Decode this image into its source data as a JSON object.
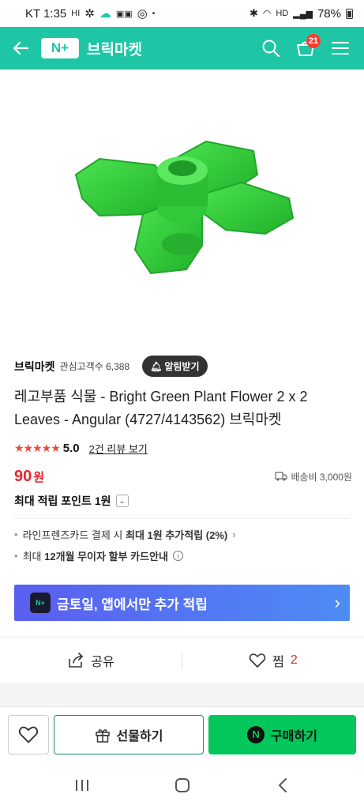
{
  "status_bar": {
    "carrier_time": "KT 1:35",
    "hi": "HI",
    "dot": "•",
    "hd": "HD",
    "battery": "78%"
  },
  "header": {
    "logo": "N+",
    "title": "브릭마켓",
    "cart_count": "21"
  },
  "store": {
    "name": "브릭마켓",
    "fans": "관심고객수 6,388",
    "alarm_label": "알림받기"
  },
  "product": {
    "title": "레고부품 식물 - Bright Green Plant Flower 2 x 2 Leaves - Angular (4727/4143562) 브릭마켓",
    "stars": "★★★★★",
    "rating": "5.0",
    "review_link": "2건 리뷰 보기",
    "price": "90",
    "price_unit": "원",
    "shipping": "배송비 3,000원",
    "points": "최대 적립 포인트 1원",
    "colors": {
      "plant": "#2ecc3a",
      "accent": "#1ec6a5",
      "price": "#e8222e"
    }
  },
  "benefits": [
    {
      "prefix": "라인프렌즈카드 결제 시 ",
      "bold": "최대 1원 추가적립 (2%)",
      "suffix": "›"
    },
    {
      "prefix": "최대 ",
      "bold": "12개월 무이자 할부 카드안내",
      "suffix": "i"
    }
  ],
  "promo": {
    "logo": "N+",
    "text": "금토일, 앱에서만 추가 적립",
    "arrow": "›"
  },
  "actions": {
    "share": "공유",
    "zzim": "찜",
    "zzim_count": "2"
  },
  "bottom": {
    "gift": "선물하기",
    "buy": "구매하기",
    "npay": "N"
  }
}
